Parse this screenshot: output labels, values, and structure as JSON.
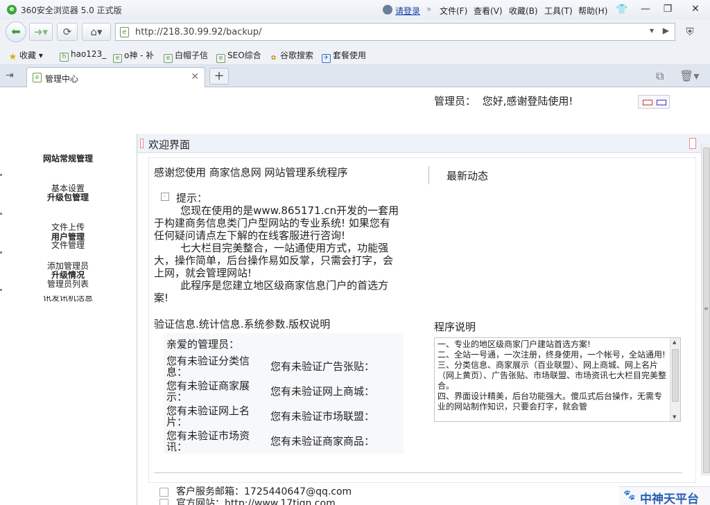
{
  "browser": {
    "title": "360安全浏览器 5.0 正式版",
    "login": "请登录",
    "menus": [
      "文件(F)",
      "查看(V)",
      "收藏(B)",
      "工具(T)",
      "帮助(H)"
    ],
    "url": "http://218.30.99.92/backup/",
    "favorites": [
      "收藏",
      "hao123_",
      "o神 - 补",
      "白帽子信",
      "SEO综合",
      "谷歌搜索",
      "套餐使用"
    ],
    "tab_title": "管理中心"
  },
  "header": {
    "admin_label": "管理员：",
    "greeting": "您好,感谢登陆使用!"
  },
  "left_nav": {
    "section1_title": "网站常规管理",
    "item_basic": "基本设置",
    "section2_title": "升级包管理",
    "item_upload": "文件上传",
    "section3_title": "用户管理",
    "item_file_mgmt": "文件管理",
    "item_add_admin": "添加管理员",
    "section4_title": "升级情况",
    "item_admin_list": "管理员列表",
    "item_clipped": "讯发讯机活息"
  },
  "panel": {
    "title": "欢迎界面",
    "thanks": "感谢您使用 商家信息网 网站管理系统程序",
    "latest": "最新动态",
    "tip_label": "提示：",
    "tip_body": "        您现在使用的是www.865171.cn开发的一套用于构建商务信息类门户型网站的专业系统! 如果您有任何疑问请点左下解的在线客服进行咨询!\n        七大栏目完美整合，一站通使用方式，功能强大，操作简单，后台操作易如反掌，只需会打字，会上网，就会管理网站!\n        此程序是您建立地区级商家信息门户的首选方案!",
    "stats_heading": "验证信息.统计信息.系统参数.版权说明",
    "program_heading": "程序说明",
    "dear_admin": "亲爱的管理员：",
    "stats": [
      {
        "left": "您有未验证分类信息：",
        "right": "您有未验证广告张贴："
      },
      {
        "left": "您有未验证商家展示：",
        "right": "您有未验证网上商城："
      },
      {
        "left": "您有未验证网上名片：",
        "right": "您有未验证市场联盟："
      },
      {
        "left": "您有未验证市场资讯：",
        "right": "您有未验证商家商品："
      }
    ],
    "program_text": "一、专业的地区级商家门户建站首选方案!\n二、全站一号通，一次注册，终身使用，一个帐号，全站通用!\n三、分类信息、商家展示（百业联盟）、网上商城、网上名片（网上黄页）、广告张贴、市场联盟、市场资讯七大栏目完美整合。\n四、界面设计精美，后台功能强大。傻瓜式后台操作，无需专业的网站制作知识，只要会打字，就会管",
    "service_email": "客户服务邮箱：1725440647@qq.com",
    "official_site": "官方网站：http://www.17tiqn.com"
  },
  "brand": "中神天平台"
}
